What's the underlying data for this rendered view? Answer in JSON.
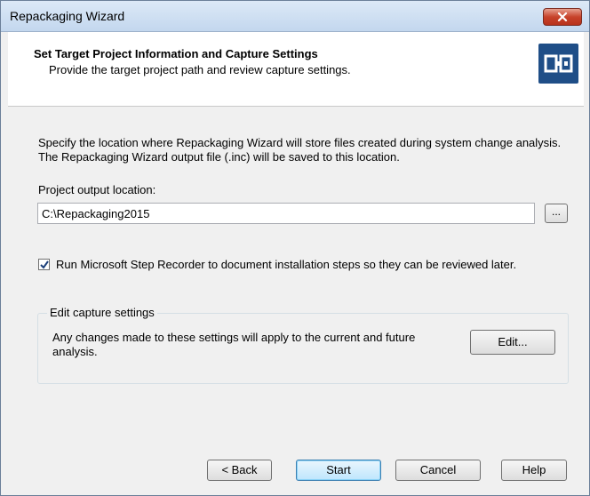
{
  "window": {
    "title": "Repackaging Wizard"
  },
  "header": {
    "title": "Set Target Project Information and Capture Settings",
    "subtitle": "Provide the target project path and review capture settings."
  },
  "content": {
    "description": "Specify the location where Repackaging Wizard will store files created during system change analysis. The Repackaging Wizard output file (.inc) will be saved to this location.",
    "output_label": "Project output location:",
    "output_value": "C:\\Repackaging2015",
    "browse_label": "...",
    "step_recorder": {
      "checked": true,
      "label": "Run Microsoft Step Recorder to document installation steps so they can be reviewed later."
    },
    "capture_group": {
      "legend": "Edit capture settings",
      "text": "Any changes made to these settings will apply to the current and future analysis.",
      "edit_label": "Edit..."
    }
  },
  "footer": {
    "back": "< Back",
    "start": "Start",
    "cancel": "Cancel",
    "help": "Help"
  },
  "colors": {
    "logo": "#1f4e87",
    "close": "#c7432b",
    "titlebar": "#c3d7ee"
  },
  "icons": {
    "close": "close-icon",
    "logo": "wizard-logo-icon",
    "check": "checkmark-icon"
  }
}
